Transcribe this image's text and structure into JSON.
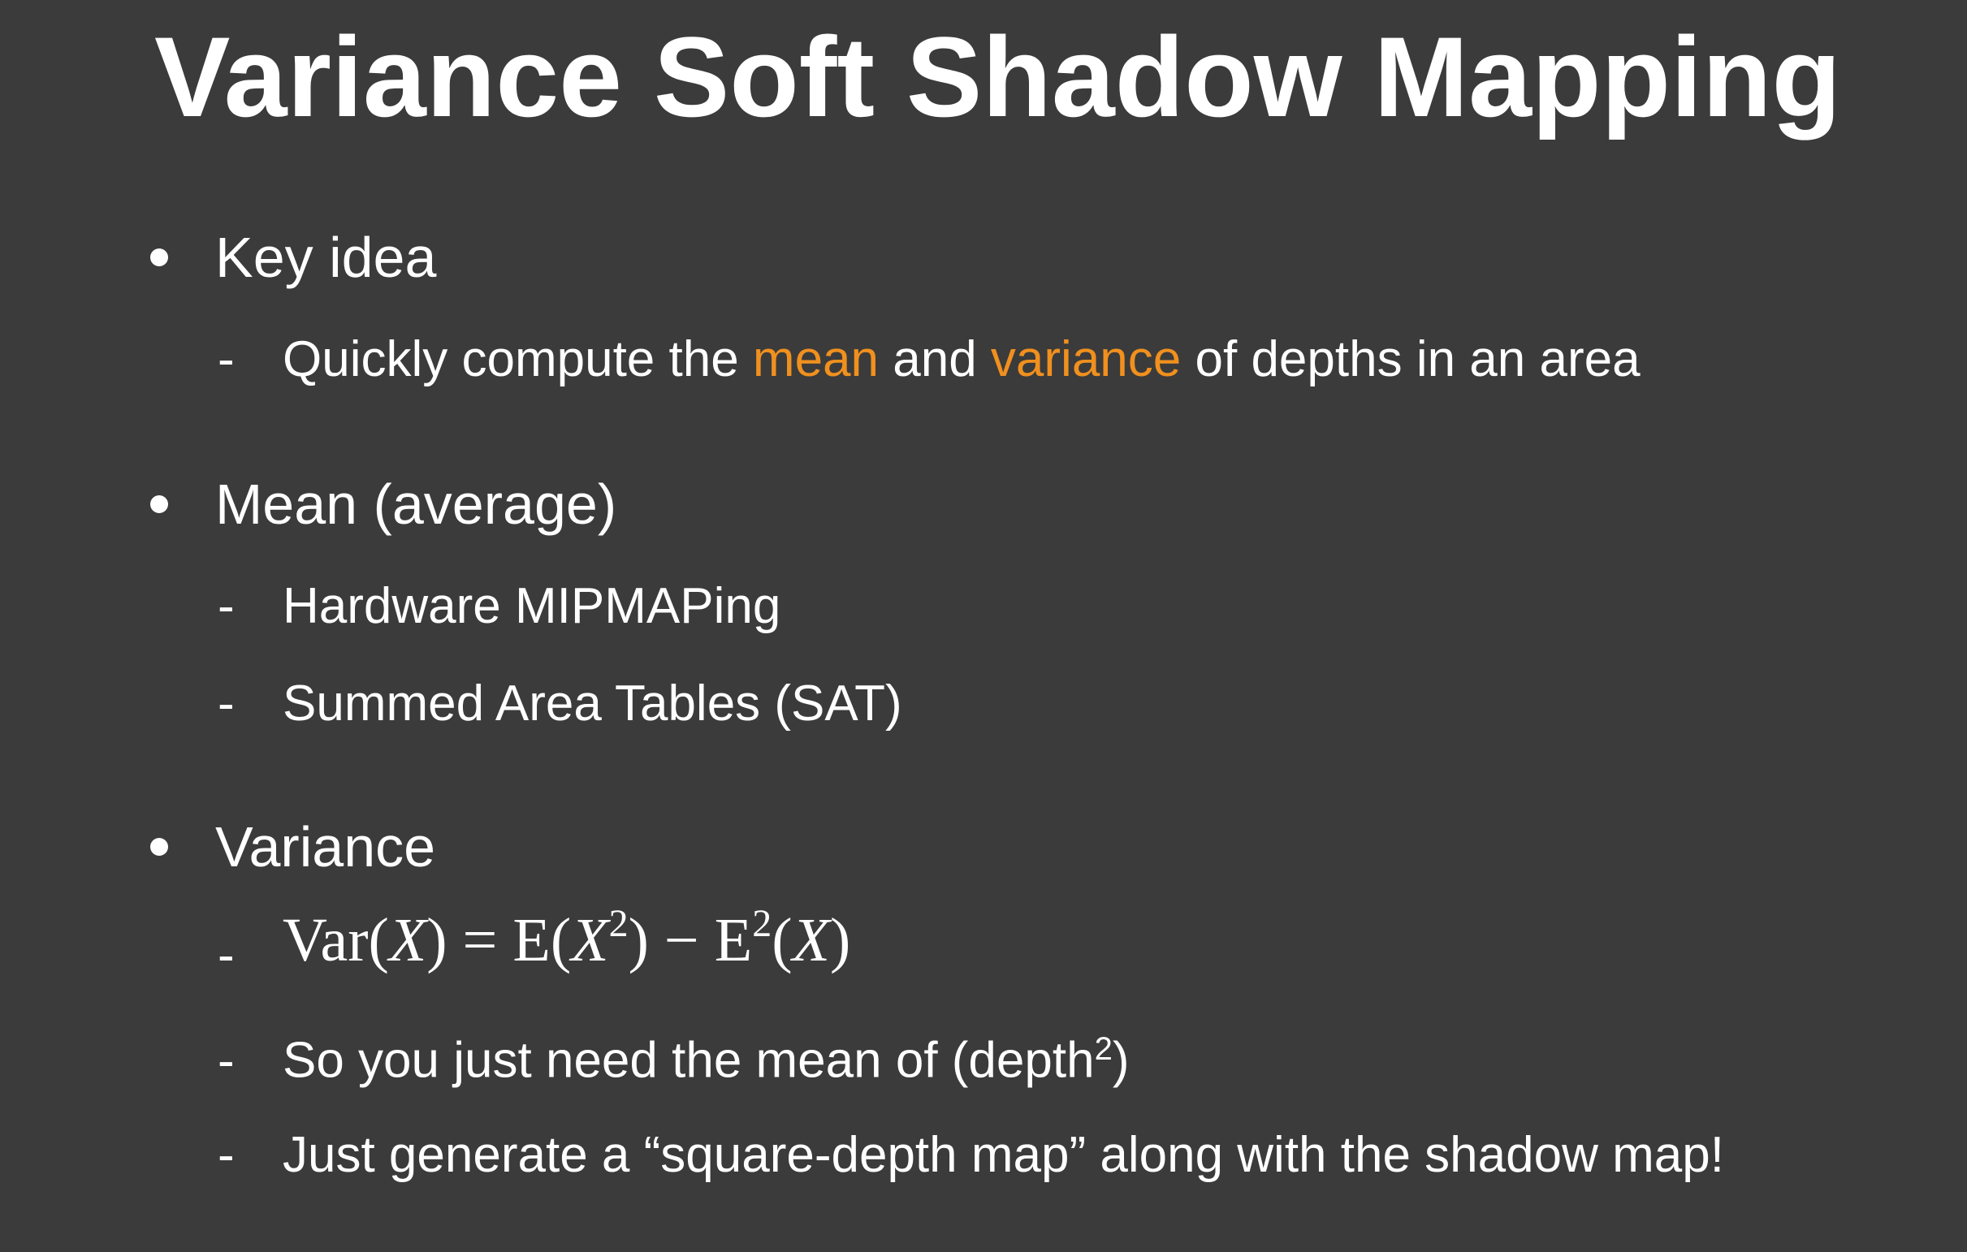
{
  "slide": {
    "title": "Variance Soft Shadow Mapping",
    "accent_color": "#f0901e",
    "background_color": "#3b3b3b",
    "bullets": [
      {
        "label": "Key idea",
        "subs": {
          "item1": {
            "part1": "Quickly compute the ",
            "highlight1": "mean",
            "part2": " and ",
            "highlight2": "variance",
            "part3": " of depths in an area"
          }
        }
      },
      {
        "label": "Mean (average)",
        "subs": [
          "Hardware MIPMAPing",
          "Summed Area Tables (SAT)"
        ]
      },
      {
        "label": "Variance",
        "formula": {
          "var": "Var(",
          "x1": "X",
          "eq": ") = E(",
          "x2": "X",
          "sup1": "2",
          "minus": ") − E",
          "sup2": "2",
          "open": "(",
          "x3": "X",
          "close": ")"
        },
        "subs": {
          "item1": {
            "text": "So you just need the mean of (depth",
            "sup": "2",
            "end": ")"
          },
          "item2": "Just generate a “square-depth map” along with the shadow map!"
        }
      }
    ],
    "dash": "-"
  }
}
